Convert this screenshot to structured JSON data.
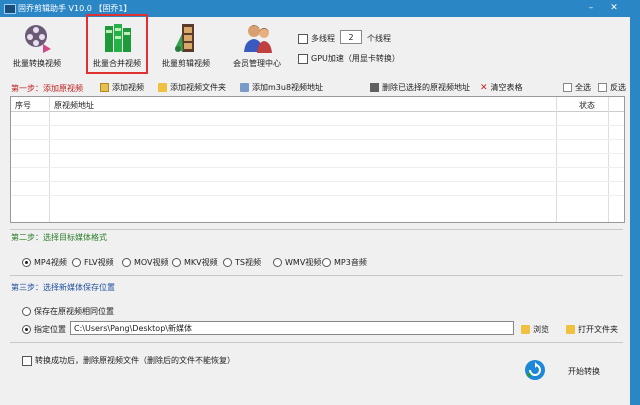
{
  "window": {
    "title": "固乔剪辑助手 V10.0  【固乔1】"
  },
  "toolbar": [
    {
      "label": "批量转换视频",
      "icon": "film-reel-icon"
    },
    {
      "label": "批量合并视频",
      "icon": "merge-blocks-icon"
    },
    {
      "label": "批量剪辑视频",
      "icon": "film-strip-icon"
    },
    {
      "label": "会员管理中心",
      "icon": "users-icon"
    }
  ],
  "options": {
    "multithread_label": "多线程",
    "thread_count": "2",
    "thread_unit": "个线程",
    "gpu_label": "GPU加速（用显卡转换）"
  },
  "step1": {
    "label": "第一步：添加原视频",
    "add_video": "添加视频",
    "add_folder": "添加视频文件夹",
    "add_m3u8": "添加m3u8视频地址",
    "delete_selected": "删除已选择的原视频地址",
    "clear_table": "清空表格",
    "select_all": "全选",
    "invert": "反选"
  },
  "table": {
    "columns": [
      "序号",
      "原视频地址",
      "状态"
    ]
  },
  "step2": {
    "label": "第二步：选择目标媒体格式",
    "formats": [
      "MP4视频",
      "FLV视频",
      "MOV视频",
      "MKV视频",
      "TS视频",
      "WMV视频",
      "MP3音频"
    ],
    "selected": "MP4视频"
  },
  "step3": {
    "label": "第三步：选择新媒体保存位置",
    "same_location": "保存在原视频相同位置",
    "specified": "指定位置",
    "path": "C:\\Users\\Pang\\Desktop\\新媒体",
    "browse": "浏览",
    "open_folder": "打开文件夹"
  },
  "footer": {
    "delete_after": "转换成功后，删除原视频文件（删除后的文件不能恢复）",
    "start": "开始转换"
  },
  "colors": {
    "titlebar": "#2b86c5",
    "highlight": "#e03030",
    "step1": "#c02020",
    "step2": "#2a7d2a",
    "step3": "#2050a0"
  }
}
